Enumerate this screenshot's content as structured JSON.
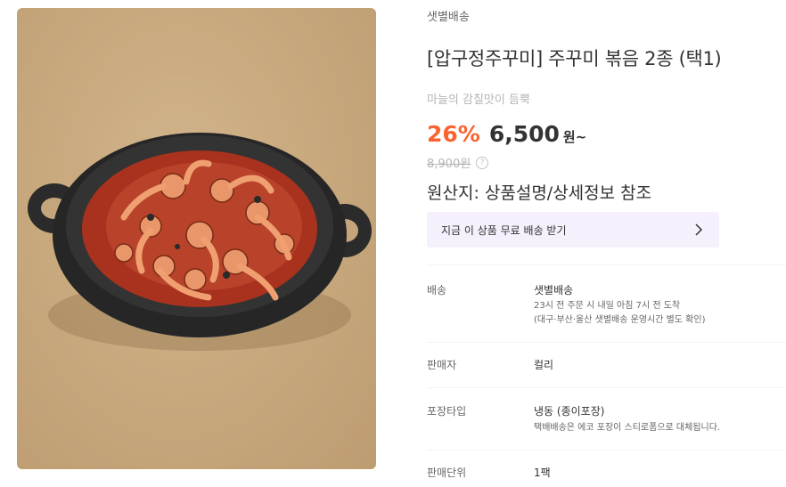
{
  "product": {
    "delivery_label": "샛별배송",
    "title": "[압구정주꾸미] 주꾸미 볶음 2종 (택1)",
    "subtitle": "마늘의 감칠맛이 듬뿍",
    "discount": "26%",
    "price": "6,500",
    "price_unit": "원~",
    "original_price": "8,900원",
    "help_icon": "?",
    "origin": "원산지: 상품설명/상세정보 참조"
  },
  "banner": {
    "text": "지금 이 상품 무료 배송 받기",
    "icon": "chevron-right-icon",
    "background": "#f6f0fc"
  },
  "details": [
    {
      "label": "배송",
      "value": "샛별배송",
      "sub1": "23시 전 주문 시 내일 아침 7시 전 도착",
      "sub2": "(대구·부산·울산 샛별배송 운영시간 별도 확인)"
    },
    {
      "label": "판매자",
      "value": "컬리"
    },
    {
      "label": "포장타입",
      "value": "냉동 (종이포장)",
      "sub1": "택배배송은 에코 포장이 스티로폼으로 대체됩니다."
    },
    {
      "label": "판매단위",
      "value": "1팩"
    }
  ],
  "colors": {
    "discount": "#fa622f",
    "muted": "#b5b5b5",
    "text": "#333333",
    "accent": "#5f0080"
  }
}
